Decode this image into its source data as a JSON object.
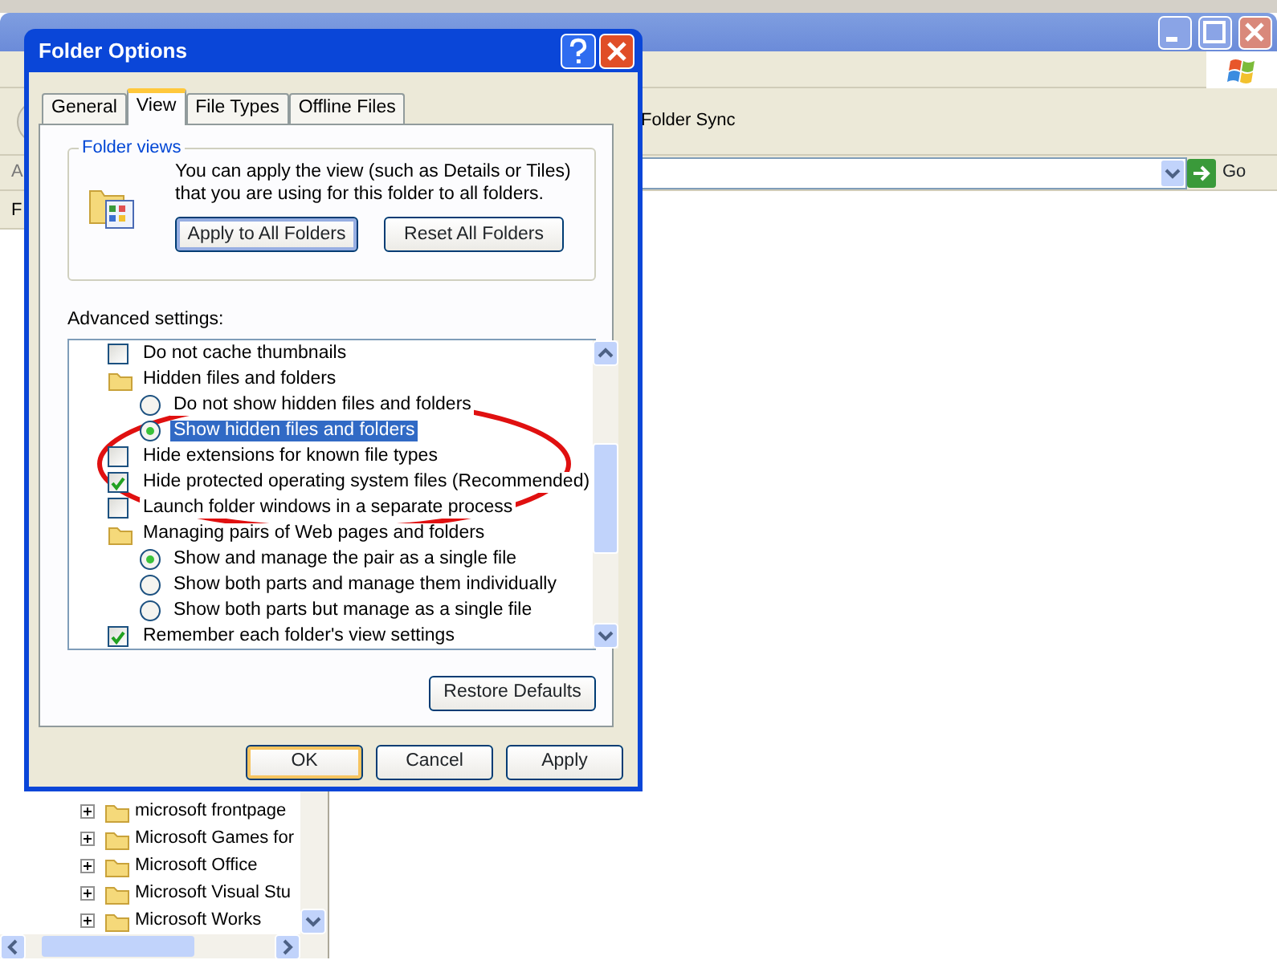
{
  "explorer": {
    "toolbar_text": "Folder Sync",
    "address_label": "A",
    "go_button": "Go",
    "folders_label": "F",
    "tree_items": [
      {
        "label": "microsoft frontpage",
        "expanded": false
      },
      {
        "label": "Microsoft Games for",
        "expanded": false
      },
      {
        "label": "Microsoft Office",
        "expanded": false
      },
      {
        "label": "Microsoft Visual Stu",
        "expanded": false
      },
      {
        "label": "Microsoft Works",
        "expanded": false
      }
    ]
  },
  "dialog": {
    "title": "Folder Options",
    "tabs": [
      {
        "label": "General",
        "selected": false
      },
      {
        "label": "View",
        "selected": true
      },
      {
        "label": "File Types",
        "selected": false
      },
      {
        "label": "Offline Files",
        "selected": false
      }
    ],
    "folder_views": {
      "title": "Folder views",
      "text": "You can apply the view (such as Details or Tiles) that you are using for this folder to all folders.",
      "buttons": [
        {
          "label": "Apply to All Folders",
          "default": true
        },
        {
          "label": "Reset All Folders",
          "default": false
        }
      ]
    },
    "advanced_label": "Advanced settings:",
    "settings": [
      {
        "kind": "checkbox",
        "label": "Do not cache thumbnails",
        "checked": false,
        "selected": false
      },
      {
        "kind": "folder",
        "label": "Hidden files and folders",
        "selected": false,
        "children": [
          {
            "kind": "radio",
            "label": "Do not show hidden files and folders",
            "checked": false,
            "selected": false
          },
          {
            "kind": "radio",
            "label": "Show hidden files and folders",
            "checked": true,
            "selected": true
          }
        ]
      },
      {
        "kind": "checkbox",
        "label": "Hide extensions for known file types",
        "checked": false,
        "selected": false
      },
      {
        "kind": "checkbox",
        "label": "Hide protected operating system files (Recommended)",
        "checked": true,
        "selected": false
      },
      {
        "kind": "checkbox",
        "label": "Launch folder windows in a separate process",
        "checked": false,
        "selected": false
      },
      {
        "kind": "folder",
        "label": "Managing pairs of Web pages and folders",
        "selected": false,
        "children": [
          {
            "kind": "radio",
            "label": "Show and manage the pair as a single file",
            "checked": true,
            "selected": false
          },
          {
            "kind": "radio",
            "label": "Show both parts and manage them individually",
            "checked": false,
            "selected": false
          },
          {
            "kind": "radio",
            "label": "Show both parts but manage as a single file",
            "checked": false,
            "selected": false
          }
        ]
      },
      {
        "kind": "checkbox",
        "label": "Remember each folder's view settings",
        "checked": true,
        "selected": false
      }
    ],
    "restore_button": "Restore Defaults",
    "buttons": [
      {
        "label": "OK",
        "default": true
      },
      {
        "label": "Cancel",
        "default": false
      },
      {
        "label": "Apply",
        "default": false
      }
    ]
  }
}
